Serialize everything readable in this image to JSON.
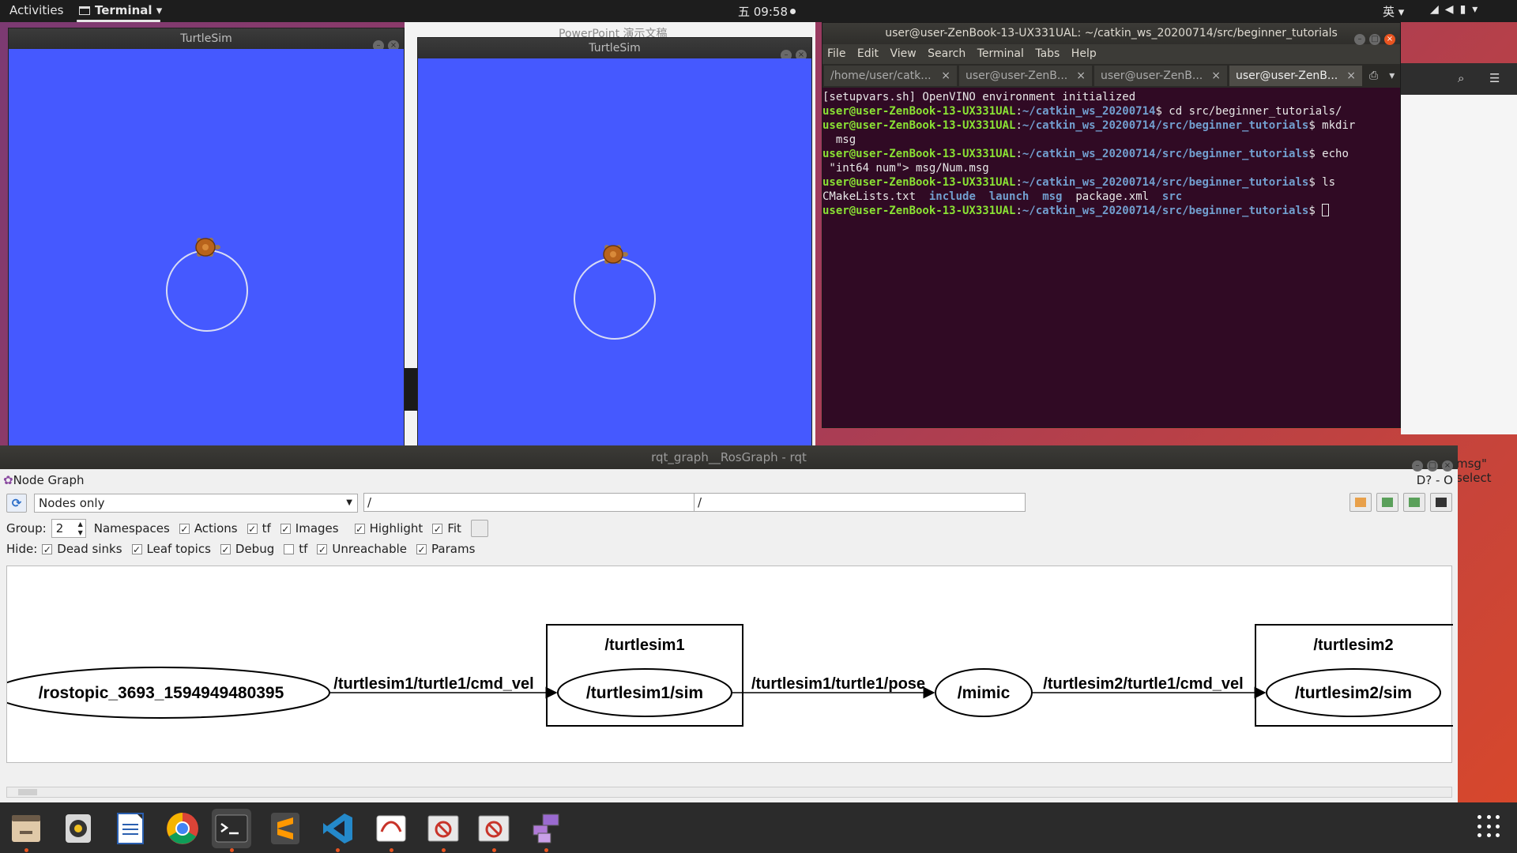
{
  "topbar": {
    "activities": "Activities",
    "app_menu": "Terminal",
    "clock": "五 09:58",
    "ime": "英"
  },
  "turtlesim1": {
    "title": "TurtleSim"
  },
  "turtlesim2": {
    "title": "TurtleSim"
  },
  "background_window": {
    "title": "PowerPoint 演示文稿"
  },
  "terminal": {
    "title": "user@user-ZenBook-13-UX331UAL: ~/catkin_ws_20200714/src/beginner_tutorials",
    "menu": [
      "File",
      "Edit",
      "View",
      "Search",
      "Terminal",
      "Tabs",
      "Help"
    ],
    "tabs": [
      "/home/user/catk...",
      "user@user-ZenB...",
      "user@user-ZenB...",
      "user@user-ZenB..."
    ],
    "line0": "[setupvars.sh] OpenVINO environment initialized",
    "user": "user@user-ZenBook-13-UX331UAL",
    "path_ws": "~/catkin_ws_20200714",
    "path_bt": "~/catkin_ws_20200714/src/beginner_tutorials",
    "cmd1": "$ cd src/beginner_tutorials/",
    "cmd2": "$ mkdir",
    "cmd2b": "  msg",
    "cmd3": "$ echo",
    "cmd3b": " \"int64 num\"> msg/Num.msg",
    "cmd4": "$ ls",
    "ls_files": [
      "CMakeLists.txt",
      "include",
      "launch",
      "msg",
      "package.xml",
      "src"
    ],
    "cmd5": "$ "
  },
  "rqt": {
    "title": "rqt_graph__RosGraph - rqt",
    "plugin_title": "Node Graph",
    "plugin_right": "D? - O",
    "mode": "Nodes only",
    "filter1": "/",
    "filter2": "/",
    "group_label": "Group:",
    "group_value": "2",
    "namespaces": "Namespaces",
    "actions": "Actions",
    "tf": "tf",
    "images": "Images",
    "highlight": "Highlight",
    "fit": "Fit",
    "hide_label": "Hide:",
    "dead_sinks": "Dead sinks",
    "leaf_topics": "Leaf topics",
    "debug": "Debug",
    "tf2": "tf",
    "unreachable": "Unreachable",
    "params": "Params"
  },
  "graph": {
    "nodes": {
      "rostopic": "/rostopic_3693_1594949480395",
      "ns1": "/turtlesim1",
      "sim1": "/turtlesim1/sim",
      "mimic": "/mimic",
      "ns2": "/turtlesim2",
      "sim2": "/turtlesim2/sim"
    },
    "edges": {
      "e1": "/turtlesim1/turtle1/cmd_vel",
      "e2": "/turtlesim1/turtle1/pose",
      "e3": "/turtlesim2/turtle1/cmd_vel"
    }
  },
  "right_panel": {
    "text": "msg\" select"
  },
  "dock": [
    "files-icon",
    "rhythmbox-icon",
    "writer-icon",
    "chrome-icon",
    "terminal-icon",
    "sublime-icon",
    "vscode-icon",
    "evince-icon",
    "turtle-app-icon",
    "turtle-app-icon-2",
    "rqt-icon"
  ]
}
